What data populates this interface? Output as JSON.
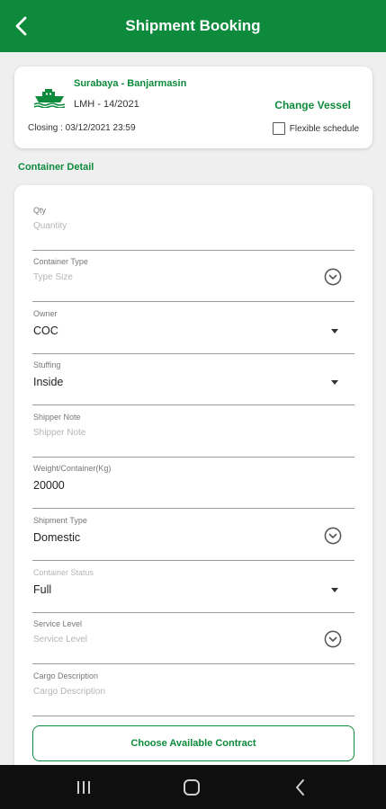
{
  "appbar": {
    "title": "Shipment Booking",
    "back_icon": "back-arrow-icon"
  },
  "vessel": {
    "route": "Surabaya - Banjarmasin",
    "voyage": "LMH - 14/2021",
    "change_label": "Change Vessel",
    "closing": "Closing : 03/12/2021 23:59",
    "flexible_label": "Flexible schedule",
    "flexible_checked": false,
    "icon": "ship-icon"
  },
  "section": {
    "title": "Container Detail"
  },
  "fields": {
    "qty": {
      "label": "Qty",
      "placeholder": "Quantity"
    },
    "container_type": {
      "label": "Container Type",
      "placeholder": "Type Size"
    },
    "owner": {
      "label": "Owner",
      "value": "COC"
    },
    "stuffing": {
      "label": "Stuffing",
      "value": "Inside"
    },
    "shipper_note": {
      "label": "Shipper Note",
      "placeholder": "Shipper Note"
    },
    "weight": {
      "label": "Weight/Container(Kg)",
      "value": "20000"
    },
    "shipment_type": {
      "label": "Shipment Type",
      "value": "Domestic"
    },
    "container_status": {
      "label": "Container Status",
      "value": "Full"
    },
    "service_level": {
      "label": "Service Level",
      "placeholder": "Service Level"
    },
    "cargo_description": {
      "label": "Cargo Description",
      "placeholder": "Cargo Description"
    }
  },
  "contract_button": {
    "label": "Choose Available Contract"
  },
  "colors": {
    "brand": "#0d8a3c",
    "background": "#efefef"
  },
  "navbar": {
    "icons": [
      "recent-apps-icon",
      "home-icon",
      "nav-back-icon"
    ]
  }
}
